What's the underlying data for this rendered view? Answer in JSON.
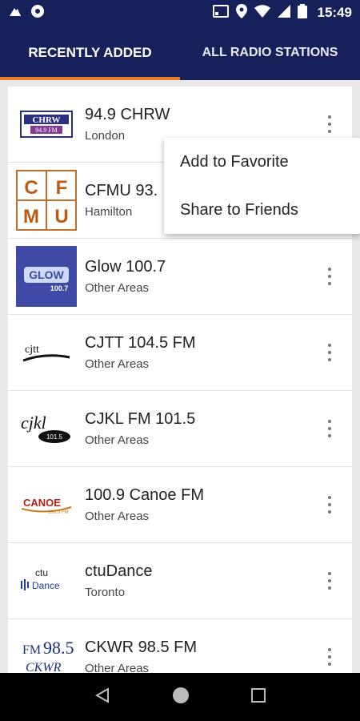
{
  "status": {
    "time": "15:49"
  },
  "tabs": [
    {
      "label": "RECENTLY ADDED",
      "active": true
    },
    {
      "label": "ALL RADIO STATIONS",
      "active": false
    }
  ],
  "stations": [
    {
      "name": "94.9 CHRW",
      "area": "London",
      "logo": "CHRW 94.9 FM"
    },
    {
      "name": "CFMU 93.",
      "area": "Hamilton",
      "logo": "CFMU"
    },
    {
      "name": "Glow 100.7",
      "area": "Other Areas",
      "logo": "GLOW 100.7"
    },
    {
      "name": "CJTT 104.5 FM",
      "area": "Other Areas",
      "logo": "cjtt"
    },
    {
      "name": "CJKL FM 101.5",
      "area": "Other Areas",
      "logo": "cjkl 101.5"
    },
    {
      "name": "100.9 Canoe FM",
      "area": "Other Areas",
      "logo": "CANOE 100.9 FM"
    },
    {
      "name": "ctuDance",
      "area": "Toronto",
      "logo": "ctu Dance"
    },
    {
      "name": "CKWR 98.5 FM",
      "area": "Other Areas",
      "logo": "FM98.5 CKWR"
    }
  ],
  "menu": {
    "favorite": "Add to Favorite",
    "share": "Share to Friends"
  },
  "colors": {
    "primary": "#16215c",
    "accent": "#e8782a"
  }
}
